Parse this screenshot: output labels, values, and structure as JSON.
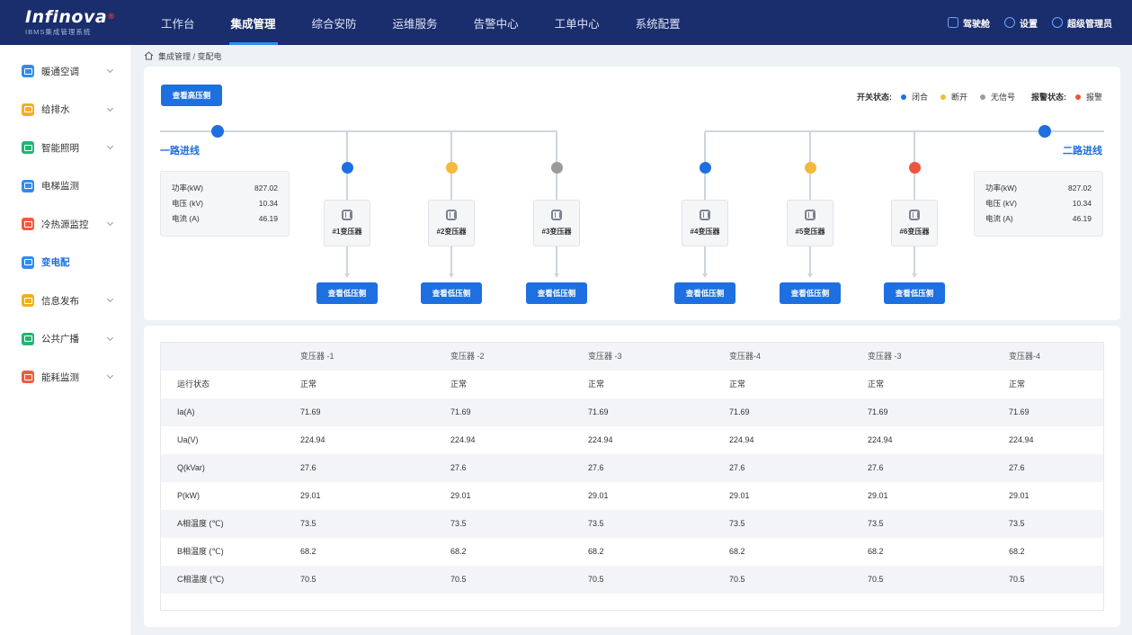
{
  "app": {
    "logo_main": "Infinova",
    "logo_mark": "®",
    "logo_sub": "IBMS集成管理系统"
  },
  "nav": [
    {
      "label": "工作台"
    },
    {
      "label": "集成管理",
      "active": true
    },
    {
      "label": "综合安防"
    },
    {
      "label": "运维服务"
    },
    {
      "label": "告警中心"
    },
    {
      "label": "工单中心"
    },
    {
      "label": "系统配置"
    }
  ],
  "top_right": {
    "cockpit": "驾驶舱",
    "settings": "设置",
    "user": "超级管理员"
  },
  "sidebar": [
    {
      "label": "暖通空调",
      "color": "#2f8cf0",
      "expandable": true
    },
    {
      "label": "给排水",
      "color": "#f2b01e",
      "expandable": true
    },
    {
      "label": "智能照明",
      "color": "#22b573",
      "expandable": true
    },
    {
      "label": "电梯监测",
      "color": "#2f8cf0",
      "expandable": false
    },
    {
      "label": "冷热源监控",
      "color": "#f25a3c",
      "expandable": true
    },
    {
      "label": "变电配",
      "color": "#2f8cf0",
      "expandable": false,
      "active": true
    },
    {
      "label": "信息发布",
      "color": "#f2b01e",
      "expandable": true
    },
    {
      "label": "公共广播",
      "color": "#22b573",
      "expandable": true
    },
    {
      "label": "能耗监测",
      "color": "#f25a3c",
      "expandable": true
    }
  ],
  "breadcrumb": "集成管理 / 变配电",
  "diagram": {
    "hv_button": "查看高压侧",
    "legend": {
      "switch_title": "开关状态:",
      "closed": "闭合",
      "open": "断开",
      "no_signal": "无信号",
      "alarm_title": "报警状态:",
      "alarm": "报警"
    },
    "colors": {
      "closed": "#1e6fe0",
      "open": "#f2b93b",
      "no_signal": "#9b9b9b",
      "alarm": "#f0533d"
    },
    "feed1": {
      "label": "一路进线",
      "rows": [
        {
          "k": "功率(kW)",
          "v": "827.02"
        },
        {
          "k": "电压 (kV)",
          "v": "10.34"
        },
        {
          "k": "电流 (A)",
          "v": "46.19"
        }
      ]
    },
    "feed2": {
      "label": "二路进线",
      "rows": [
        {
          "k": "功率(kW)",
          "v": "827.02"
        },
        {
          "k": "电压 (kV)",
          "v": "10.34"
        },
        {
          "k": "电流 (A)",
          "v": "46.19"
        }
      ]
    },
    "transformers": [
      {
        "label": "#1变压器",
        "status": "closed",
        "button": "查看低压侧"
      },
      {
        "label": "#2变压器",
        "status": "open",
        "button": "查看低压侧"
      },
      {
        "label": "#3变压器",
        "status": "no_signal",
        "button": "查看低压侧"
      },
      {
        "label": "#4变压器",
        "status": "closed",
        "button": "查看低压侧"
      },
      {
        "label": "#5变压器",
        "status": "open",
        "button": "查看低压侧"
      },
      {
        "label": "#6变压器",
        "status": "alarm",
        "button": "查看低压侧"
      }
    ]
  },
  "table": {
    "columns": [
      "",
      "变压器 -1",
      "变压器 -2",
      "变压器 -3",
      "变压器-4",
      "变压器 -3",
      "变压器-4"
    ],
    "rows": [
      [
        "运行状态",
        "正常",
        "正常",
        "正常",
        "正常",
        "正常",
        "正常"
      ],
      [
        "Ia(A)",
        "71.69",
        "71.69",
        "71.69",
        "71.69",
        "71.69",
        "71.69"
      ],
      [
        "Ua(V)",
        "224.94",
        "224.94",
        "224.94",
        "224.94",
        "224.94",
        "224.94"
      ],
      [
        "Q(kVar)",
        "27.6",
        "27.6",
        "27.6",
        "27.6",
        "27.6",
        "27.6"
      ],
      [
        "P(kW)",
        "29.01",
        "29.01",
        "29.01",
        "29.01",
        "29.01",
        "29.01"
      ],
      [
        "A相温度 (℃)",
        "73.5",
        "73.5",
        "73.5",
        "73.5",
        "73.5",
        "73.5"
      ],
      [
        "B相温度 (℃)",
        "68.2",
        "68.2",
        "68.2",
        "68.2",
        "68.2",
        "68.2"
      ],
      [
        "C相温度 (℃)",
        "70.5",
        "70.5",
        "70.5",
        "70.5",
        "70.5",
        "70.5"
      ]
    ]
  }
}
